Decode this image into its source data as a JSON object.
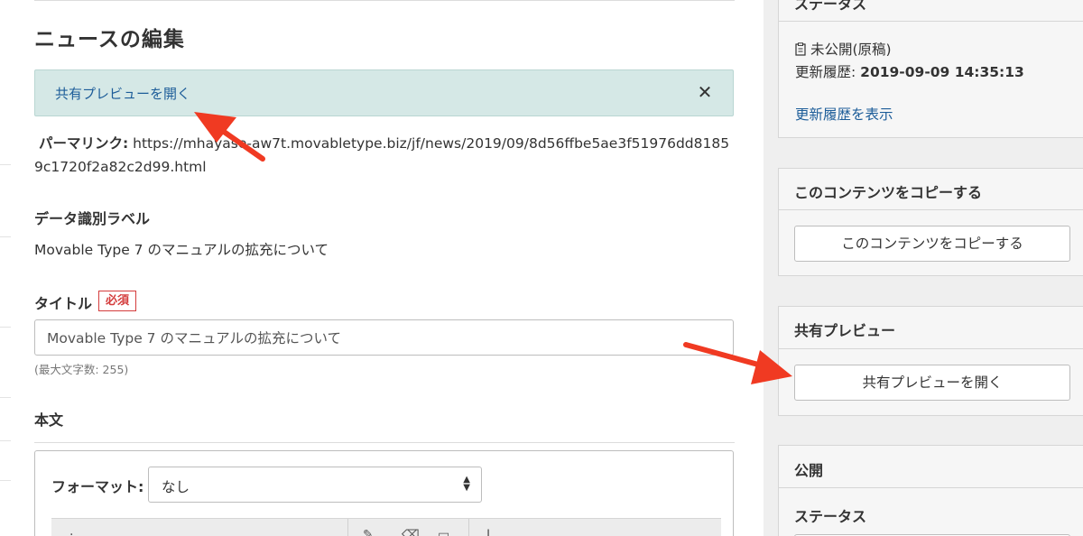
{
  "page": {
    "title": "ニュースの編集"
  },
  "alert": {
    "link_text": "共有プレビューを開く",
    "close_glyph": "✕"
  },
  "permalink": {
    "label": "パーマリンク:",
    "url": "https://mhayase-aw7t.movabletype.biz/jf/news/2019/09/8d56ffbe5ae3f51976dd81859c1720f2a82c2d99.html"
  },
  "data_label": {
    "label": "データ識別ラベル",
    "value": "Movable Type 7 のマニュアルの拡充について"
  },
  "title_field": {
    "label": "タイトル",
    "required": "必須",
    "value": "Movable Type 7 のマニュアルの拡充について",
    "hint": "(最大文字数: 255)"
  },
  "body_field": {
    "label": "本文",
    "format_label": "フォーマット:",
    "format_value": "なし"
  },
  "sidebar": {
    "status_widget": {
      "title": "ステータス",
      "state": "未公開(原稿)",
      "history_label": "更新履歴:",
      "history_value": "2019-09-09 14:35:13",
      "history_link": "更新履歴を表示"
    },
    "copy_widget": {
      "title": "このコンテンツをコピーする",
      "button": "このコンテンツをコピーする"
    },
    "preview_widget": {
      "title": "共有プレビュー",
      "button": "共有プレビューを開く"
    },
    "publish_widget": {
      "title": "公開",
      "sub_label": "ステータス"
    }
  },
  "colors": {
    "annotation_arrow": "#f03a22",
    "link": "#1d5d99",
    "required": "#d43c3c",
    "alert_bg": "#d5e8e6"
  }
}
